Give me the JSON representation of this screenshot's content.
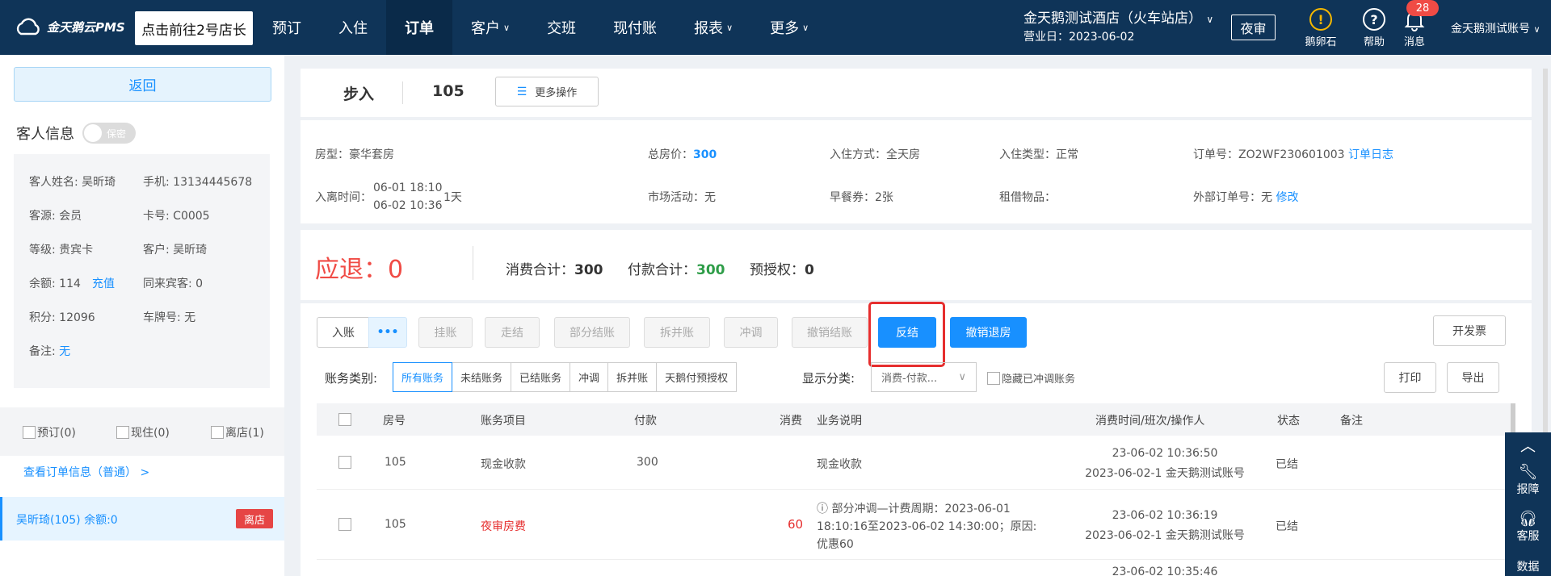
{
  "topbar": {
    "logo": "金天鹅云PMS",
    "tooltip": "点击前往2号店长",
    "nav": [
      {
        "label": "预订",
        "caret": false
      },
      {
        "label": "入住",
        "caret": false
      },
      {
        "label": "订单",
        "caret": false,
        "active": true
      },
      {
        "label": "客户",
        "caret": true
      },
      {
        "label": "交班",
        "caret": false
      },
      {
        "label": "现付账",
        "caret": false
      },
      {
        "label": "报表",
        "caret": true
      },
      {
        "label": "更多",
        "caret": true
      }
    ],
    "hotel_name": "金天鹅测试酒店（火车站店）",
    "business_day": "营业日：2023-06-02",
    "night_audit": "夜审",
    "icons": {
      "egg": "鹅卵石",
      "help": "帮助",
      "message": "消息"
    },
    "message_count": "28",
    "account": "金天鹅测试账号"
  },
  "left": {
    "back": "返回",
    "guest_info_title": "客人信息",
    "privacy_toggle": "保密",
    "guest": {
      "name": "客人姓名: 吴昕琦",
      "phone": "手机: 13134445678",
      "source": "客源: 会员",
      "card": "卡号: C0005",
      "level": "等级: 贵宾卡",
      "customer": "客户: 吴昕琦",
      "balance": "余额: 114",
      "recharge": "充值",
      "companions": "同来宾客: 0",
      "points": "积分: 12096",
      "plate": "车牌号: 无",
      "remark_label": "备注: ",
      "remark_value": "无"
    },
    "status_tabs": [
      "预订(0)",
      "现住(0)",
      "离店(1)"
    ],
    "order_link": "查看订单信息（普通） >",
    "guest_row": {
      "name": "吴昕琦(105)   余额:0",
      "tag": "离店"
    }
  },
  "order": {
    "status": "步入",
    "room": "105",
    "more_ops": "更多操作",
    "details": {
      "room_type": "房型：豪华套房",
      "total_price_label": "总房价：",
      "total_price": "300",
      "checkin_method": "入住方式：全天房",
      "checkin_type": "入住类型：正常",
      "order_no": "订单号：ZO2WF230601003",
      "order_log": "订单日志",
      "stay_label": "入离时间：",
      "stay_in": "06-01 18:10",
      "stay_out": "06-02 10:36",
      "stay_days": "1天",
      "market": "市场活动：无",
      "breakfast": "早餐券：2张",
      "rentals": "租借物品：",
      "external_no": "外部订单号：无",
      "modify": "修改"
    }
  },
  "summary": {
    "refund_label": "应退：0",
    "consume_label": "消费合计：",
    "consume": "300",
    "paid_label": "付款合计：",
    "paid": "300",
    "preauth_label": "预授权：",
    "preauth": "0"
  },
  "actions": {
    "post": "入账",
    "dots": "•••",
    "hang": "挂账",
    "walk": "走结",
    "partial": "部分结账",
    "split": "拆并账",
    "reverse": "冲调",
    "cancel_settle": "撤销结账",
    "unsettle": "反结",
    "cancel_checkout": "撤销退房",
    "invoice": "开发票",
    "print": "打印",
    "export": "导出"
  },
  "filters": {
    "category_label": "账务类别:",
    "categories": [
      "所有账务",
      "未结账务",
      "已结账务",
      "冲调",
      "拆并账",
      "天鹅付预授权"
    ],
    "display_label": "显示分类:",
    "display_value": "消费-付款...",
    "hide_reversed": "隐藏已冲调账务"
  },
  "table": {
    "headers": {
      "room": "房号",
      "item": "账务项目",
      "pay": "付款",
      "consume": "消费",
      "desc": "业务说明",
      "time": "消费时间/班次/操作人",
      "status": "状态",
      "remark": "备注"
    },
    "rows": [
      {
        "room": "105",
        "item": "现金收款",
        "pay": "300",
        "consume": "",
        "desc": "现金收款",
        "time1": "23-06-02 10:36:50",
        "time2": "2023-06-02-1 金天鹅测试账号",
        "status": "已结"
      },
      {
        "room": "105",
        "item": "夜审房费",
        "pay": "",
        "consume": "60",
        "desc1": "ⓘ 部分冲调—计费周期：2023-06-01",
        "desc2": "18:10:16至2023-06-02 14:30:00；原因:",
        "desc3": "优惠60",
        "time1": "23-06-02 10:36:19",
        "time2": "2023-06-02-1 金天鹅测试账号",
        "status": "已结"
      },
      {
        "time1": "23-06-02 10:35:46"
      }
    ]
  },
  "side_tools": {
    "report": "报障",
    "service": "客服",
    "data": "数据"
  }
}
